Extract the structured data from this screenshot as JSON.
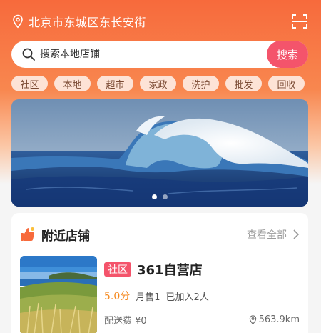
{
  "header": {
    "location": "北京市东城区东长安街",
    "location_icon": "location-pin-icon",
    "scan_icon": "scan-icon"
  },
  "search": {
    "placeholder": "搜索本地店铺",
    "button_label": "搜索"
  },
  "categories": [
    "社区",
    "本地",
    "超市",
    "家政",
    "洗护",
    "批发",
    "回收"
  ],
  "banner": {
    "slides_total": 2,
    "active_index": 0
  },
  "nearby": {
    "title": "附近店铺",
    "view_all_label": "查看全部",
    "stores": [
      {
        "tag": "社区",
        "name": "361自营店",
        "rating": "5.0分",
        "sold": "月售1",
        "joined": "已加入2人",
        "delivery_fee": "配送费 ¥0",
        "distance": "563.9km"
      }
    ]
  },
  "colors": {
    "brand_orange": "#f76a3c",
    "accent_pink": "#f4546b",
    "rating_orange": "#f5891f"
  }
}
